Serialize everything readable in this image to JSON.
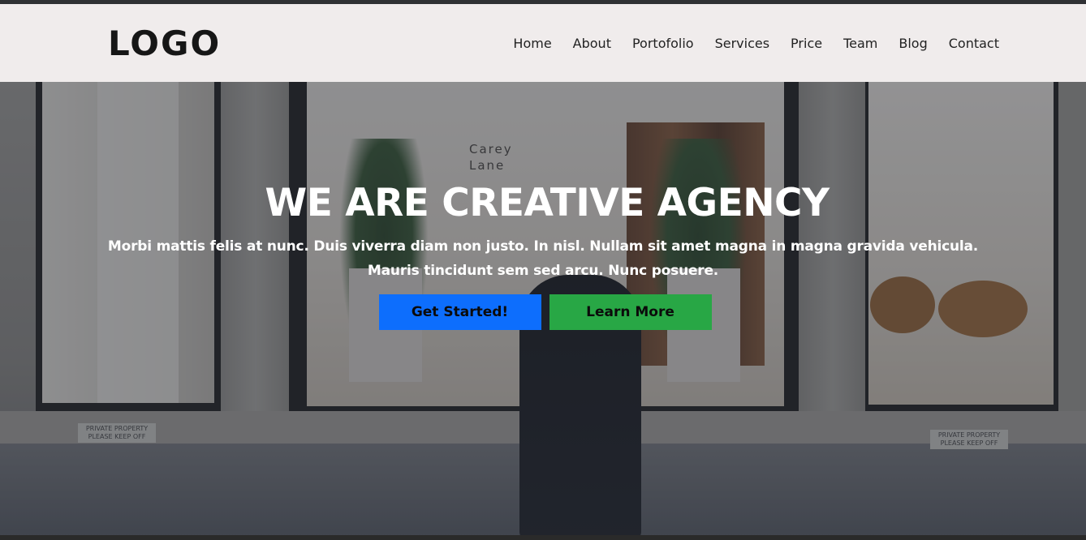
{
  "brand": {
    "logo_text": "LOGO"
  },
  "nav": {
    "items": [
      {
        "label": "Home"
      },
      {
        "label": "About"
      },
      {
        "label": "Portofolio"
      },
      {
        "label": "Services"
      },
      {
        "label": "Price"
      },
      {
        "label": "Team"
      },
      {
        "label": "Blog"
      },
      {
        "label": "Contact"
      }
    ]
  },
  "hero": {
    "title": "WE ARE CREATIVE AGENCY",
    "line1": "Morbi mattis felis at nunc. Duis viverra diam non justo. In nisl. Nullam sit amet magna in magna gravida vehicula.",
    "line2": "Mauris tincidunt sem sed arcu. Nunc posuere.",
    "primary_button": "Get Started!",
    "secondary_button": "Learn More"
  },
  "background": {
    "sign_left": "PRIVATE PROPERTY PLEASE KEEP OFF",
    "sign_right": "PRIVATE PROPERTY PLEASE KEEP OFF",
    "storefront_sign": "Carey Lane"
  },
  "colors": {
    "navbar_bg": "#f0ecec",
    "primary_button": "#0d6efd",
    "success_button": "#28a745",
    "hero_text": "#ffffff"
  }
}
